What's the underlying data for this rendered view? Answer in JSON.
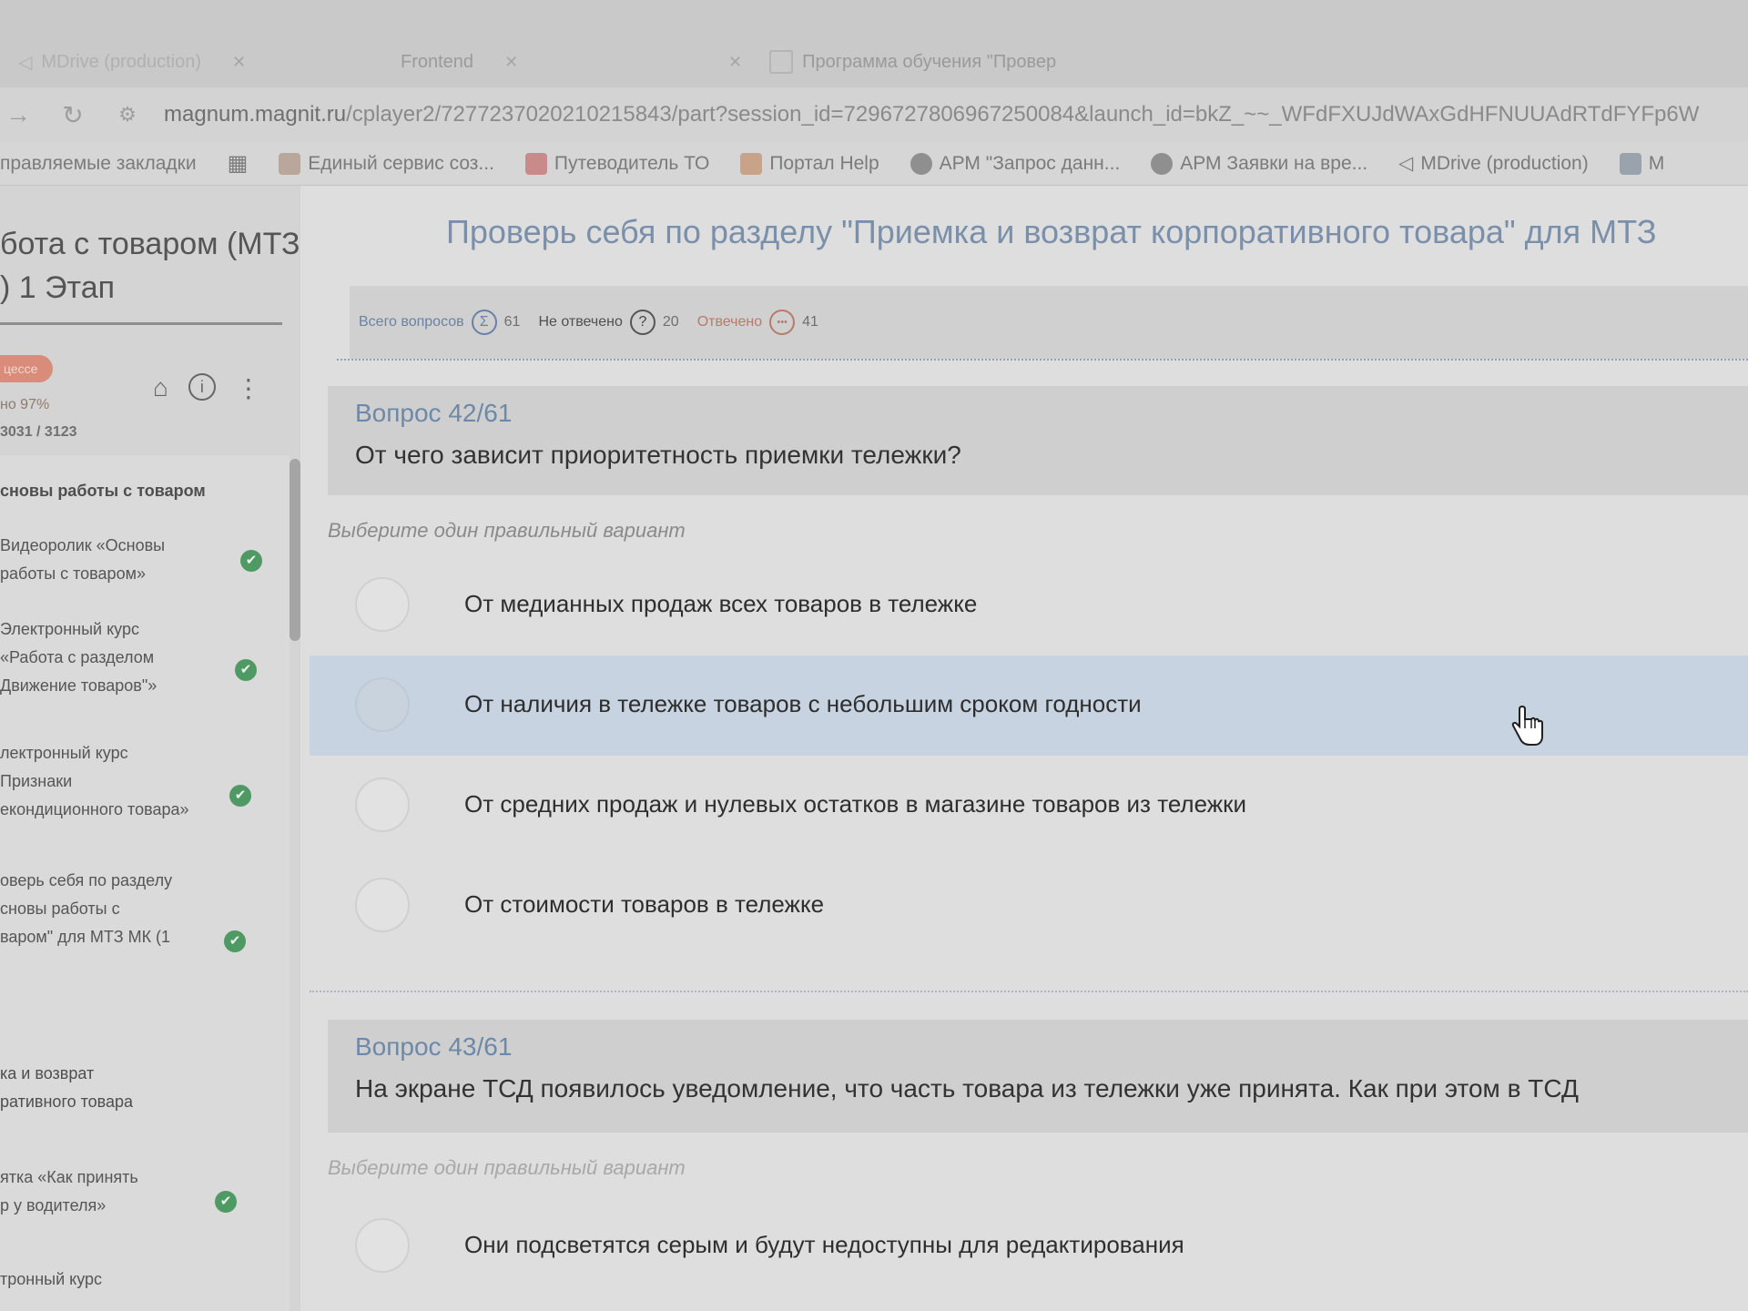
{
  "browser": {
    "tabs": [
      {
        "label": "MDrive (production)"
      },
      {
        "label": "Frontend"
      },
      {
        "label": "Программа обучения \"Провер"
      }
    ],
    "url_host": "magnum.magnit.ru",
    "url_path": "/cplayer2/7277237020210215843/part?session_id=7296727806967250084&launch_id=bkZ_~~_WFdFXUJdWAxGdHFNUUAdRTdFYFp6W",
    "bookmarks": [
      {
        "label": "правляемые закладки"
      },
      {
        "label": "Единый сервис соз..."
      },
      {
        "label": "Путеводитель ТО"
      },
      {
        "label": "Портал Help"
      },
      {
        "label": "АРМ \"Запрос данн..."
      },
      {
        "label": "АРМ Заявки на вре..."
      },
      {
        "label": "MDrive (production)"
      },
      {
        "label": "M"
      }
    ]
  },
  "sidebar": {
    "title_line1": "бота с товаром (МТЗ",
    "title_line2": ") 1 Этап",
    "status": "цессе",
    "progress": "но 97%",
    "points": "3031 / 3123",
    "items": [
      {
        "lines": [
          "сновы работы с товаром"
        ],
        "done": false,
        "head": true
      },
      {
        "lines": [
          "Видеоролик «Основы",
          "работы с товаром»"
        ],
        "done": true
      },
      {
        "lines": [
          "Электронный курс",
          "«Работа с разделом",
          "Движение товаров\"»"
        ],
        "done": true
      },
      {
        "lines": [
          "лектронный курс",
          "Признаки",
          "екондиционного товара»"
        ],
        "done": true
      },
      {
        "lines": [
          "оверь себя по разделу",
          "сновы работы с",
          "варом\" для МТЗ МК (1"
        ],
        "done": true
      },
      {
        "lines": [
          "ка и возврат",
          "ративного товара"
        ],
        "done": false
      },
      {
        "lines": [
          "ятка «Как принять",
          "р у водителя»"
        ],
        "done": true
      },
      {
        "lines": [
          "тронный курс"
        ],
        "done": false
      }
    ]
  },
  "main": {
    "title": "Проверь себя по разделу \"Приемка и возврат корпоративного товара\" для МТЗ",
    "stats": {
      "total_label": "Всего вопросов",
      "total": "61",
      "unanswered_label": "Не отвечено",
      "unanswered": "20",
      "answered_label": "Отвечено",
      "answered": "41"
    },
    "q1": {
      "number": "Вопрос 42/61",
      "text": "От чего зависит приоритетность приемки тележки?",
      "hint": "Выберите один правильный вариант",
      "options": [
        "От медианных продаж всех товаров в тележке",
        "От наличия в тележке товаров с небольшим сроком годности",
        "От средних продаж и нулевых остатков в магазине товаров из тележки",
        "От стоимости товаров в тележке"
      ],
      "selected_index": 1
    },
    "q2": {
      "number": "Вопрос 43/61",
      "text": "На экране ТСД появилось уведомление, что часть товара из тележки уже принята. Как при этом в ТСД",
      "hint": "Выберите один правильный вариант",
      "options": [
        "Они подсветятся серым и будут недоступны для редактирования"
      ]
    }
  }
}
